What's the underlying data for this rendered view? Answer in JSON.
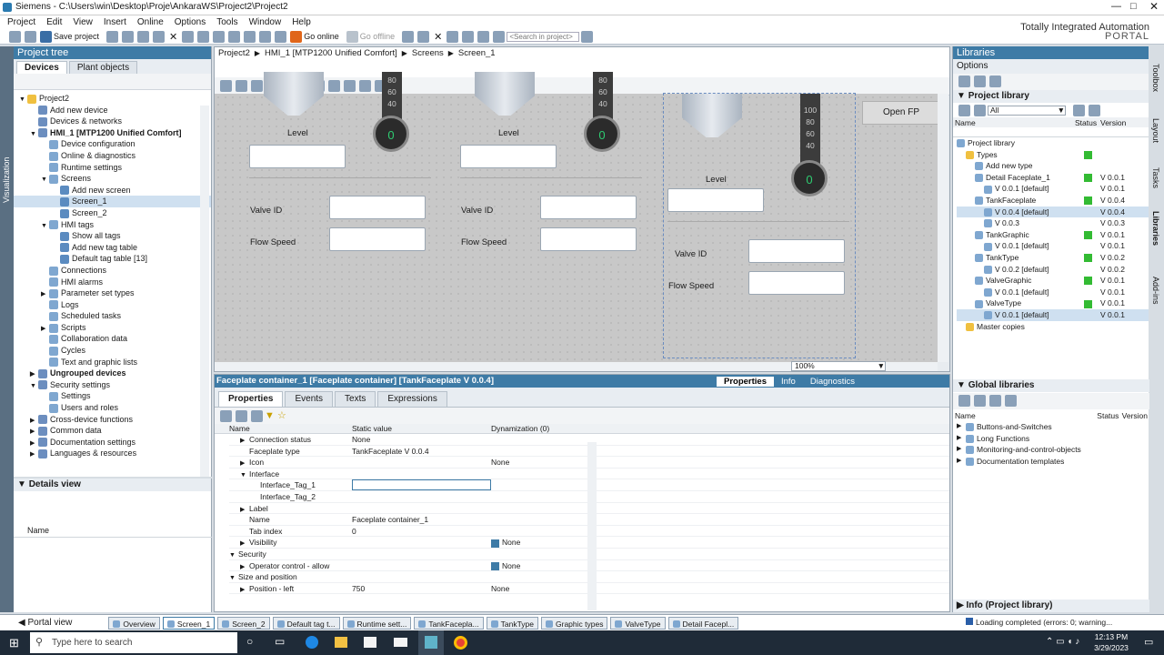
{
  "app": {
    "title": "Siemens  -  C:\\Users\\win\\Desktop\\Proje\\AnkaraWS\\Project2\\Project2",
    "brand1": "Totally Integrated Automation",
    "brand2": "PORTAL"
  },
  "menu": [
    "Project",
    "Edit",
    "View",
    "Insert",
    "Online",
    "Options",
    "Tools",
    "Window",
    "Help"
  ],
  "toolbar": {
    "save": "Save project",
    "go_online": "Go online",
    "go_offline": "Go offline",
    "search_placeholder": "<Search in project>"
  },
  "project_tree": {
    "title": "Project tree",
    "tab_devices": "Devices",
    "tab_plant": "Plant objects",
    "side_label": "Visualization",
    "items": [
      {
        "label": "Project2",
        "indent": 0,
        "arrow": "▼"
      },
      {
        "label": "Add new device",
        "indent": 1,
        "arrow": ""
      },
      {
        "label": "Devices & networks",
        "indent": 1,
        "arrow": ""
      },
      {
        "label": "HMI_1 [MTP1200 Unified Comfort]",
        "indent": 1,
        "arrow": "▼",
        "bold": true
      },
      {
        "label": "Device configuration",
        "indent": 2,
        "arrow": ""
      },
      {
        "label": "Online & diagnostics",
        "indent": 2,
        "arrow": ""
      },
      {
        "label": "Runtime settings",
        "indent": 2,
        "arrow": ""
      },
      {
        "label": "Screens",
        "indent": 2,
        "arrow": "▼"
      },
      {
        "label": "Add new screen",
        "indent": 3,
        "arrow": ""
      },
      {
        "label": "Screen_1",
        "indent": 3,
        "arrow": "",
        "sel": true
      },
      {
        "label": "Screen_2",
        "indent": 3,
        "arrow": ""
      },
      {
        "label": "HMI tags",
        "indent": 2,
        "arrow": "▼"
      },
      {
        "label": "Show all tags",
        "indent": 3,
        "arrow": ""
      },
      {
        "label": "Add new tag table",
        "indent": 3,
        "arrow": ""
      },
      {
        "label": "Default tag table [13]",
        "indent": 3,
        "arrow": ""
      },
      {
        "label": "Connections",
        "indent": 2,
        "arrow": ""
      },
      {
        "label": "HMI alarms",
        "indent": 2,
        "arrow": ""
      },
      {
        "label": "Parameter set types",
        "indent": 2,
        "arrow": "▶"
      },
      {
        "label": "Logs",
        "indent": 2,
        "arrow": ""
      },
      {
        "label": "Scheduled tasks",
        "indent": 2,
        "arrow": ""
      },
      {
        "label": "Scripts",
        "indent": 2,
        "arrow": "▶"
      },
      {
        "label": "Collaboration data",
        "indent": 2,
        "arrow": ""
      },
      {
        "label": "Cycles",
        "indent": 2,
        "arrow": ""
      },
      {
        "label": "Text and graphic lists",
        "indent": 2,
        "arrow": ""
      },
      {
        "label": "Ungrouped devices",
        "indent": 1,
        "arrow": "▶",
        "bold": true
      },
      {
        "label": "Security settings",
        "indent": 1,
        "arrow": "▼"
      },
      {
        "label": "Settings",
        "indent": 2,
        "arrow": ""
      },
      {
        "label": "Users and roles",
        "indent": 2,
        "arrow": ""
      },
      {
        "label": "Cross-device functions",
        "indent": 1,
        "arrow": "▶"
      },
      {
        "label": "Common data",
        "indent": 1,
        "arrow": "▶"
      },
      {
        "label": "Documentation settings",
        "indent": 1,
        "arrow": "▶"
      },
      {
        "label": "Languages & resources",
        "indent": 1,
        "arrow": "▶"
      }
    ]
  },
  "details": {
    "title": "Details view",
    "col_name": "Name"
  },
  "editor": {
    "breadcrumb": [
      "Project2",
      "HMI_1 [MTP1200 Unified Comfort]",
      "Screens",
      "Screen_1"
    ],
    "zoom": "100%"
  },
  "screen": {
    "faceplates": [
      {
        "level": "Level",
        "gauge_value": "0",
        "scale": [
          "80",
          "60",
          "40"
        ],
        "valve_id": "Valve ID",
        "flow_speed": "Flow Speed"
      },
      {
        "level": "Level",
        "gauge_value": "0",
        "scale": [
          "80",
          "60",
          "40"
        ],
        "valve_id": "Valve ID",
        "flow_speed": "Flow Speed"
      },
      {
        "level": "Level",
        "gauge_value": "0",
        "scale": [
          "100",
          "80",
          "60",
          "40"
        ],
        "valve_id": "Valve ID",
        "flow_speed": "Flow Speed"
      }
    ],
    "open_fp": "Open FP"
  },
  "inspector": {
    "title": "Faceplate container_1 [Faceplate container] [TankFaceplate V 0.0.4]",
    "tabs_right": [
      "Properties",
      "Info",
      "Diagnostics"
    ],
    "tabs": [
      "Properties",
      "Events",
      "Texts",
      "Expressions"
    ],
    "col_name": "Name",
    "col_static": "Static value",
    "col_dyn": "Dynamization (0)",
    "rows": [
      {
        "name": "Connection status",
        "value": "None",
        "dyn": "",
        "indent": 1,
        "arrow": "▶"
      },
      {
        "name": "Faceplate type",
        "value": "TankFaceplate V 0.0.4",
        "dyn": "",
        "indent": 1,
        "arrow": ""
      },
      {
        "name": "Icon",
        "value": "",
        "dyn": "None",
        "indent": 1,
        "arrow": "▶"
      },
      {
        "name": "Interface",
        "value": "",
        "dyn": "",
        "indent": 1,
        "arrow": "▼"
      },
      {
        "name": "Interface_Tag_1",
        "value": "",
        "dyn": "",
        "indent": 2,
        "arrow": "",
        "edit": true
      },
      {
        "name": "Interface_Tag_2",
        "value": "",
        "dyn": "",
        "indent": 2,
        "arrow": ""
      },
      {
        "name": "Label",
        "value": "",
        "dyn": "",
        "indent": 1,
        "arrow": "▶"
      },
      {
        "name": "Name",
        "value": "Faceplate container_1",
        "dyn": "",
        "indent": 1,
        "arrow": ""
      },
      {
        "name": "Tab index",
        "value": "0",
        "dyn": "",
        "indent": 1,
        "arrow": ""
      },
      {
        "name": "Visibility",
        "value": "",
        "dyn": "None",
        "indent": 1,
        "arrow": "▶",
        "check": true
      },
      {
        "name": "Security",
        "value": "",
        "dyn": "",
        "indent": 0,
        "arrow": "▼"
      },
      {
        "name": "Operator control - allow",
        "value": "",
        "dyn": "None",
        "indent": 1,
        "arrow": "▶",
        "check": true
      },
      {
        "name": "Size and position",
        "value": "",
        "dyn": "",
        "indent": 0,
        "arrow": "▼"
      },
      {
        "name": "Position - left",
        "value": "750",
        "dyn": "None",
        "indent": 1,
        "arrow": "▶"
      }
    ]
  },
  "libraries": {
    "title": "Libraries",
    "options": "Options",
    "project_library": "Project library",
    "filter": "All",
    "col_name": "Name",
    "col_status": "Status",
    "col_version": "Version",
    "rows": [
      {
        "name": "Project library",
        "indent": 0,
        "status": false,
        "version": ""
      },
      {
        "name": "Types",
        "indent": 1,
        "status": true,
        "version": ""
      },
      {
        "name": "Add new type",
        "indent": 2,
        "status": false,
        "version": ""
      },
      {
        "name": "Detail Faceplate_1",
        "indent": 2,
        "status": true,
        "version": "V 0.0.1"
      },
      {
        "name": "V 0.0.1 [default]",
        "indent": 3,
        "status": false,
        "version": "V 0.0.1"
      },
      {
        "name": "TankFaceplate",
        "indent": 2,
        "status": true,
        "version": "V 0.0.4"
      },
      {
        "name": "V 0.0.4 [default]",
        "indent": 3,
        "status": false,
        "version": "V 0.0.4",
        "sel": true
      },
      {
        "name": "V 0.0.3",
        "indent": 3,
        "status": false,
        "version": "V 0.0.3"
      },
      {
        "name": "TankGraphic",
        "indent": 2,
        "status": true,
        "version": "V 0.0.1"
      },
      {
        "name": "V 0.0.1 [default]",
        "indent": 3,
        "status": false,
        "version": "V 0.0.1"
      },
      {
        "name": "TankType",
        "indent": 2,
        "status": true,
        "version": "V 0.0.2"
      },
      {
        "name": "V 0.0.2 [default]",
        "indent": 3,
        "status": false,
        "version": "V 0.0.2"
      },
      {
        "name": "ValveGraphic",
        "indent": 2,
        "status": true,
        "version": "V 0.0.1"
      },
      {
        "name": "V 0.0.1 [default]",
        "indent": 3,
        "status": false,
        "version": "V 0.0.1"
      },
      {
        "name": "ValveType",
        "indent": 2,
        "status": true,
        "version": "V 0.0.1"
      },
      {
        "name": "V 0.0.1 [default]",
        "indent": 3,
        "status": false,
        "version": "V 0.0.1",
        "sel": true
      },
      {
        "name": "Master copies",
        "indent": 1,
        "status": false,
        "version": ""
      }
    ],
    "global_title": "Global libraries",
    "global_rows": [
      "Buttons-and-Switches",
      "Long Functions",
      "Monitoring-and-control-objects",
      "Documentation templates"
    ],
    "info_footer": "Info (Project library)",
    "right_tabs": [
      "Toolbox",
      "Layout",
      "Tasks",
      "Libraries",
      "Add-ins"
    ]
  },
  "portal_bar": {
    "portal_view": "Portal view",
    "tasks": [
      "Overview",
      "Screen_1",
      "Screen_2",
      "Default tag t...",
      "Runtime sett...",
      "TankFacepla...",
      "TankType",
      "Graphic types",
      "ValveType",
      "Detail Facepl..."
    ],
    "status": "Loading completed (errors: 0; warning..."
  },
  "taskbar": {
    "search": "Type here to search",
    "time": "12:13 PM",
    "date": "3/29/2023"
  }
}
